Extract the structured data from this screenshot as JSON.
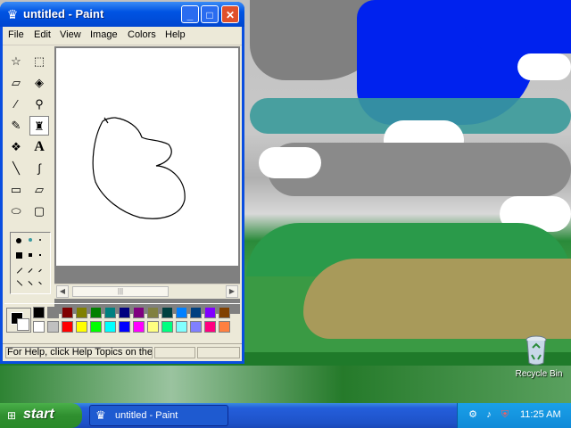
{
  "window": {
    "title": "untitled - Paint",
    "title_icon": "paint-icon",
    "controls": {
      "minimize": "minimize-icon",
      "maximize": "maximize-icon",
      "close": "close-icon"
    }
  },
  "menu": [
    "File",
    "Edit",
    "View",
    "Image",
    "Colors",
    "Help"
  ],
  "tools": [
    {
      "name": "free-form-select-icon"
    },
    {
      "name": "select-icon"
    },
    {
      "name": "eraser-icon"
    },
    {
      "name": "fill-icon"
    },
    {
      "name": "pick-color-icon"
    },
    {
      "name": "magnifier-icon"
    },
    {
      "name": "pencil-icon",
      "selected": true
    },
    {
      "name": "brush-icon"
    },
    {
      "name": "airbrush-icon"
    },
    {
      "name": "text-icon",
      "glyph": "A"
    },
    {
      "name": "line-icon"
    },
    {
      "name": "curve-icon"
    },
    {
      "name": "rectangle-icon"
    },
    {
      "name": "polygon-icon"
    },
    {
      "name": "ellipse-icon"
    },
    {
      "name": "rounded-rectangle-icon"
    }
  ],
  "palette": {
    "foreground": "#000000",
    "background": "#ffffff",
    "row1": [
      "#000000",
      "#808080",
      "#800000",
      "#808000",
      "#008000",
      "#008080",
      "#000080",
      "#800080",
      "#808040",
      "#004040",
      "#0080ff",
      "#004080",
      "#8000ff",
      "#804000"
    ],
    "row2": [
      "#ffffff",
      "#c0c0c0",
      "#ff0000",
      "#ffff00",
      "#00ff00",
      "#00ffff",
      "#0000ff",
      "#ff00ff",
      "#ffff80",
      "#00ff80",
      "#80ffff",
      "#8080ff",
      "#ff0080",
      "#ff8040"
    ]
  },
  "status": {
    "text": "For Help, click Help Topics on the H"
  },
  "desktop": {
    "recycle_bin_label": "Recycle Bin"
  },
  "taskbar": {
    "start_label": "start",
    "task_label": "untitled - Paint",
    "clock": "11:25 AM"
  }
}
